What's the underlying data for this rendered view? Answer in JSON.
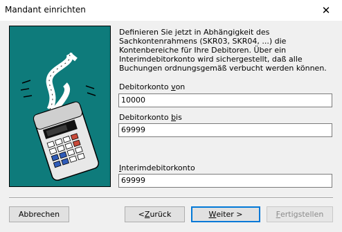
{
  "window": {
    "title": "Mandant einrichten",
    "close_glyph": "✕"
  },
  "description": "Definieren Sie jetzt in Abhängigkeit des Sachkontenrahmens (SKR03, SKR04, ...) die Kontenbereiche für Ihre Debitoren. Über ein Interimdebitorkonto wird sichergestellt, daß alle Buchungen ordnungsgemäß verbucht werden können.",
  "illustration": {
    "icon": "calculator-with-paper-tape-icon",
    "background_color": "#0e7b7b"
  },
  "fields": {
    "debitor_von": {
      "label_pre": "Debitorkonto ",
      "label_accel": "v",
      "label_post": "on",
      "value": "10000"
    },
    "debitor_bis": {
      "label_pre": "Debitorkonto ",
      "label_accel": "b",
      "label_post": "is",
      "value": "69999"
    },
    "interim": {
      "label_pre": "",
      "label_accel": "I",
      "label_post": "nterimdebitorkonto",
      "value": "69999"
    }
  },
  "buttons": {
    "abbrechen": "Abbrechen",
    "zurueck_pre": "< ",
    "zurueck_accel": "Z",
    "zurueck_post": "urück",
    "weiter_pre": "",
    "weiter_accel": "W",
    "weiter_post": "eiter >",
    "fertig_pre": "",
    "fertig_accel": "F",
    "fertig_post": "ertigstellen"
  },
  "colors": {
    "default_button_border": "#0078d7",
    "panel_teal": "#0e7b7b"
  }
}
